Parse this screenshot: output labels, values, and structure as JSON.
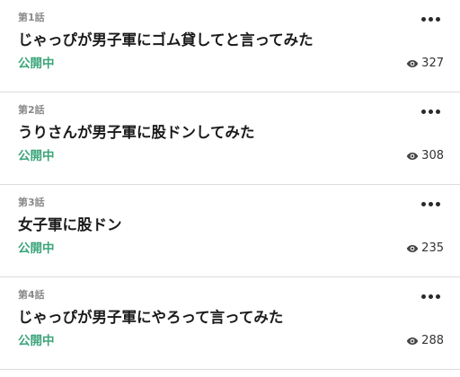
{
  "episodes": [
    {
      "number": "第1話",
      "title": "じゃっぴが男子軍にゴム貸してと言ってみた",
      "status": "公開中",
      "views": "327"
    },
    {
      "number": "第2話",
      "title": "うりさんが男子軍に股ドンしてみた",
      "status": "公開中",
      "views": "308"
    },
    {
      "number": "第3話",
      "title": "女子軍に股ドン",
      "status": "公開中",
      "views": "235"
    },
    {
      "number": "第4話",
      "title": "じゃっぴが男子軍にやろって言ってみた",
      "status": "公開中",
      "views": "288"
    }
  ],
  "icons": {
    "more": "more-icon",
    "views": "eye-icon"
  },
  "colors": {
    "status": "#3aa47a",
    "divider": "#dcdcdc"
  }
}
